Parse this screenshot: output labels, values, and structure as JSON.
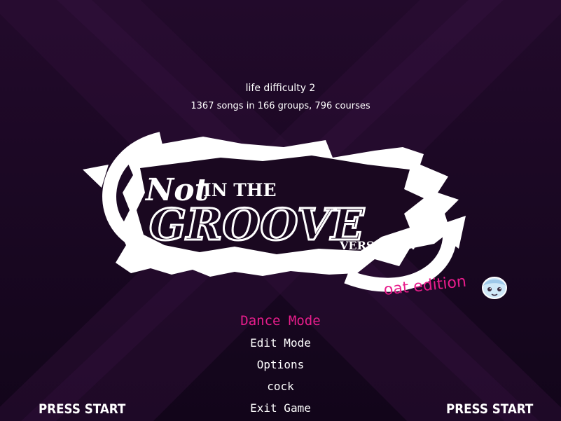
{
  "header": {
    "difficulty": "life difficulty 2",
    "song_count": "1367 songs in 166 groups, 796 courses"
  },
  "logo": {
    "line1_a": "Not",
    "line1_b": "IN THE",
    "line2": "GROOVE",
    "line3": "VERSION IV",
    "edition": "oat edition"
  },
  "menu": {
    "items": [
      {
        "label": "Dance Mode",
        "selected": true
      },
      {
        "label": "Edit Mode",
        "selected": false
      },
      {
        "label": "Options",
        "selected": false
      },
      {
        "label": "cock",
        "selected": false
      },
      {
        "label": "Exit Game",
        "selected": false
      }
    ]
  },
  "players": {
    "p1": "PRESS START",
    "p2": "PRESS START"
  },
  "colors": {
    "background": "#1a0820",
    "accent": "#e81d8c",
    "text": "#ffffff"
  },
  "icons": [
    "mascot-face-icon"
  ]
}
